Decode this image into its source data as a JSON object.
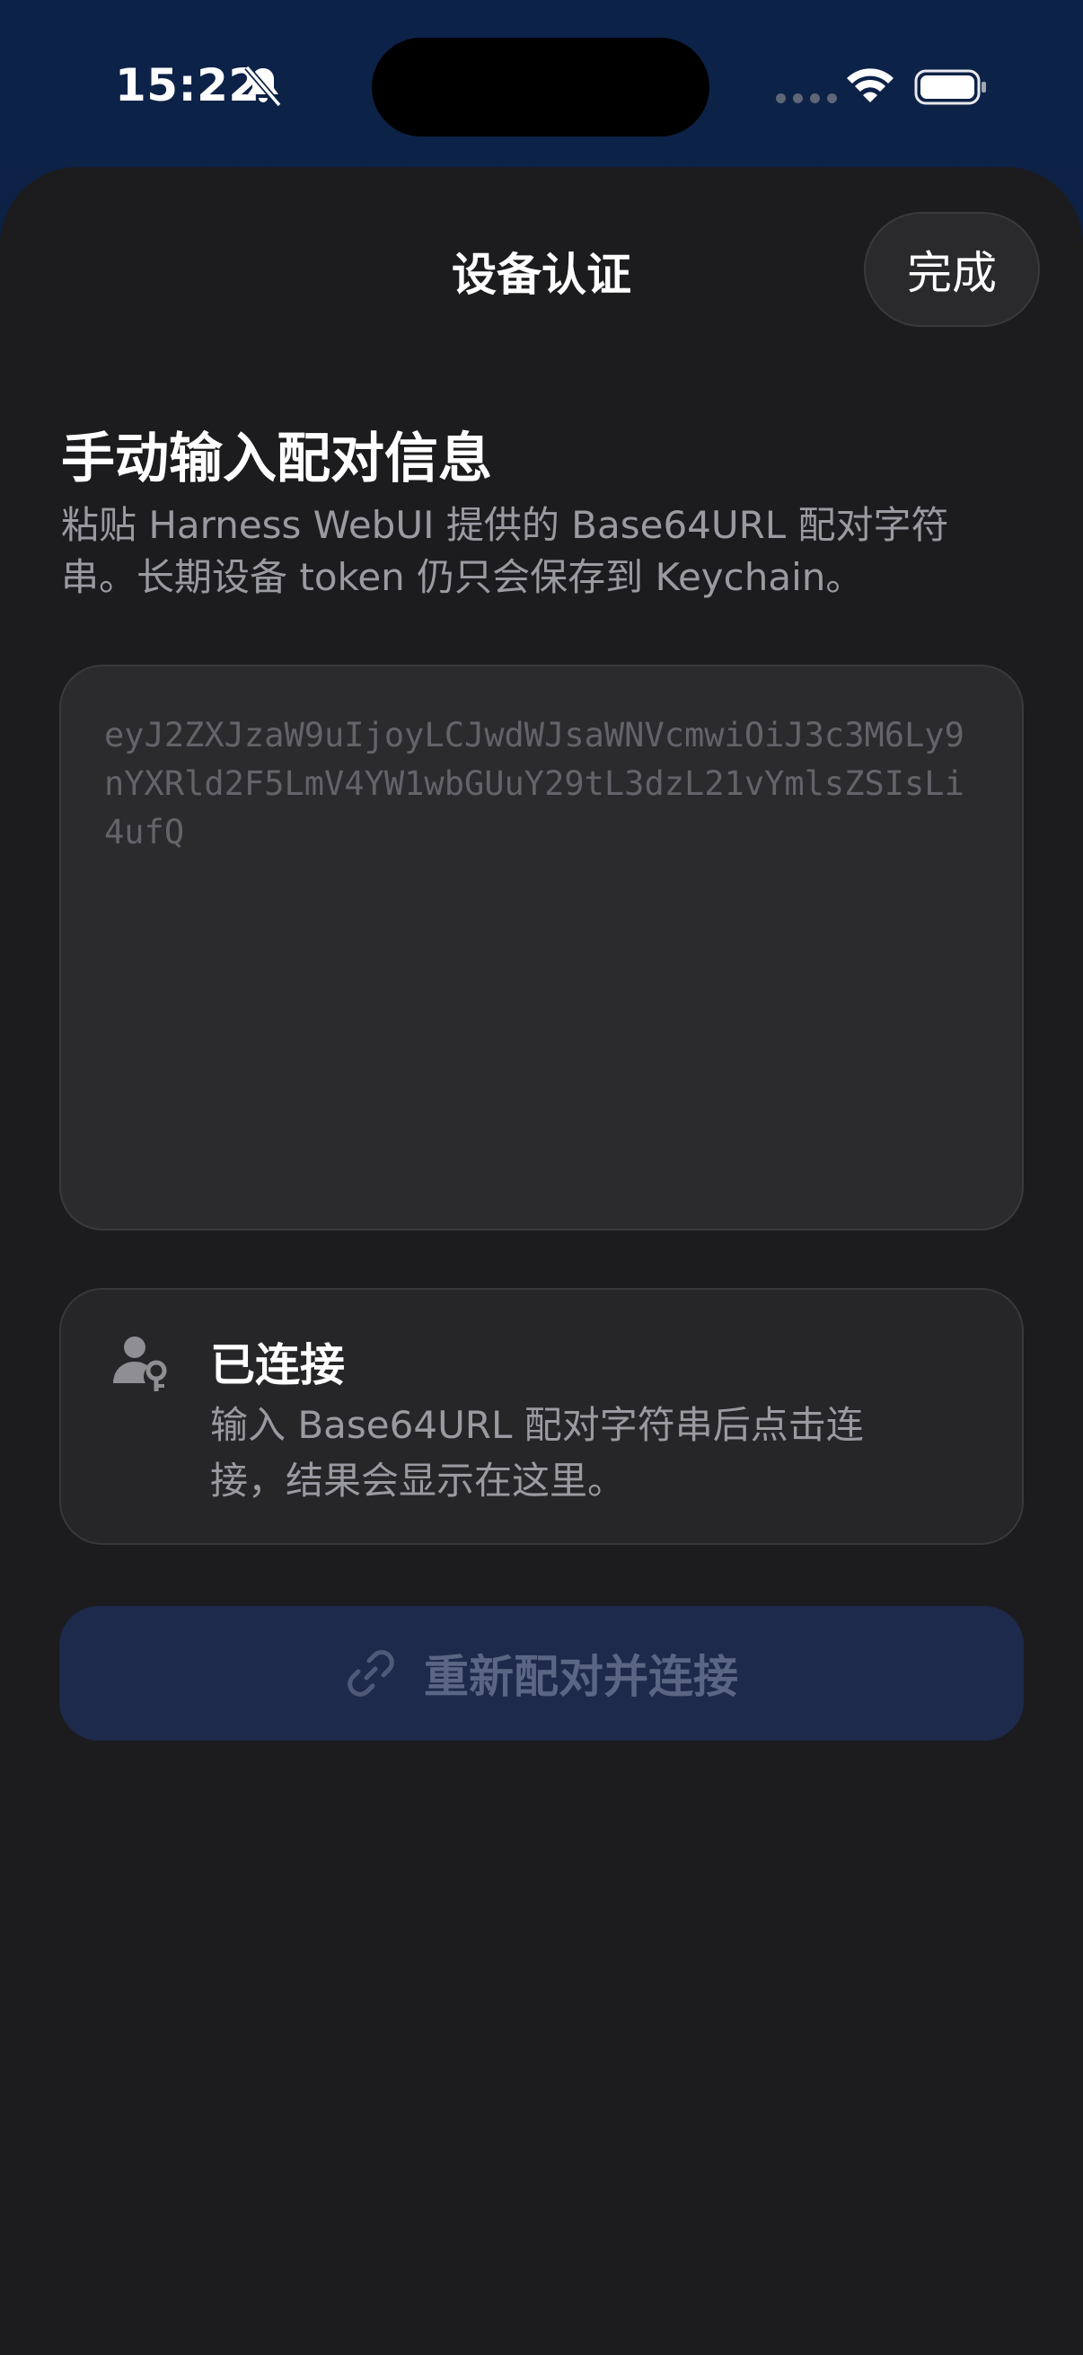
{
  "status_bar": {
    "time": "15:22",
    "icons": [
      "bell-slash-icon",
      "cellular-icon",
      "wifi-icon",
      "battery-icon"
    ]
  },
  "nav": {
    "title": "设备认证",
    "done_label": "完成"
  },
  "section": {
    "title": "手动输入配对信息",
    "description": "粘贴 Harness WebUI 提供的 Base64URL 配对字符串。长期设备 token 仍只会保存到 Keychain。"
  },
  "pairing_input": {
    "placeholder": "eyJ2ZXJzaW9uIjoyLCJwdWJsaWNVcmwiOiJ3c3M6Ly9nYXRld2F5LmV4YW1wbGUuY29tL3dzL21vYmlsZSIsLi4ufQ",
    "value": ""
  },
  "status_card": {
    "icon": "person-key-icon",
    "title": "已连接",
    "text": "输入 Base64URL 配对字符串后点击连接，结果会显示在这里。"
  },
  "primary_button": {
    "icon": "link-icon",
    "label": "重新配对并连接",
    "enabled": false
  },
  "colors": {
    "sheet_background": "#1c1c1e",
    "secondary_text": "#9a9aa1",
    "disabled_button": "#1d2a4b",
    "disabled_button_text": "#5a6683"
  }
}
